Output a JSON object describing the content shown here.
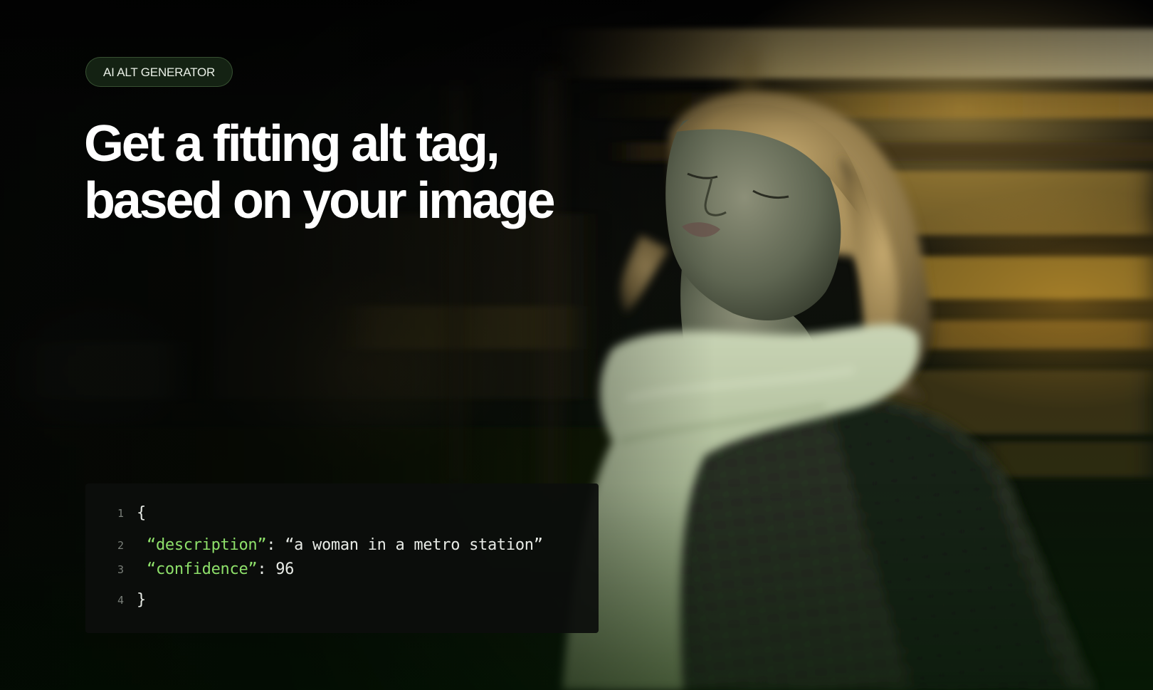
{
  "hero": {
    "badge_label": "AI ALT GENERATOR",
    "headline_line1": "Get a fitting alt tag,",
    "headline_line2": "based on your image"
  },
  "code_sample": {
    "lines": [
      {
        "number": "1",
        "open_brace": "{"
      },
      {
        "number": "2",
        "key": "“description”",
        "separator": ": ",
        "value": "“a woman in a metro station”"
      },
      {
        "number": "3",
        "key": "“confidence”",
        "separator": ": ",
        "value": "96"
      },
      {
        "number": "4",
        "close_brace": "}"
      }
    ]
  },
  "colors": {
    "json_key": "#8ee06a",
    "code_text": "#e8ebe6",
    "line_number": "#7a7f79",
    "badge_background": "#182816",
    "headline": "#ffffff"
  }
}
